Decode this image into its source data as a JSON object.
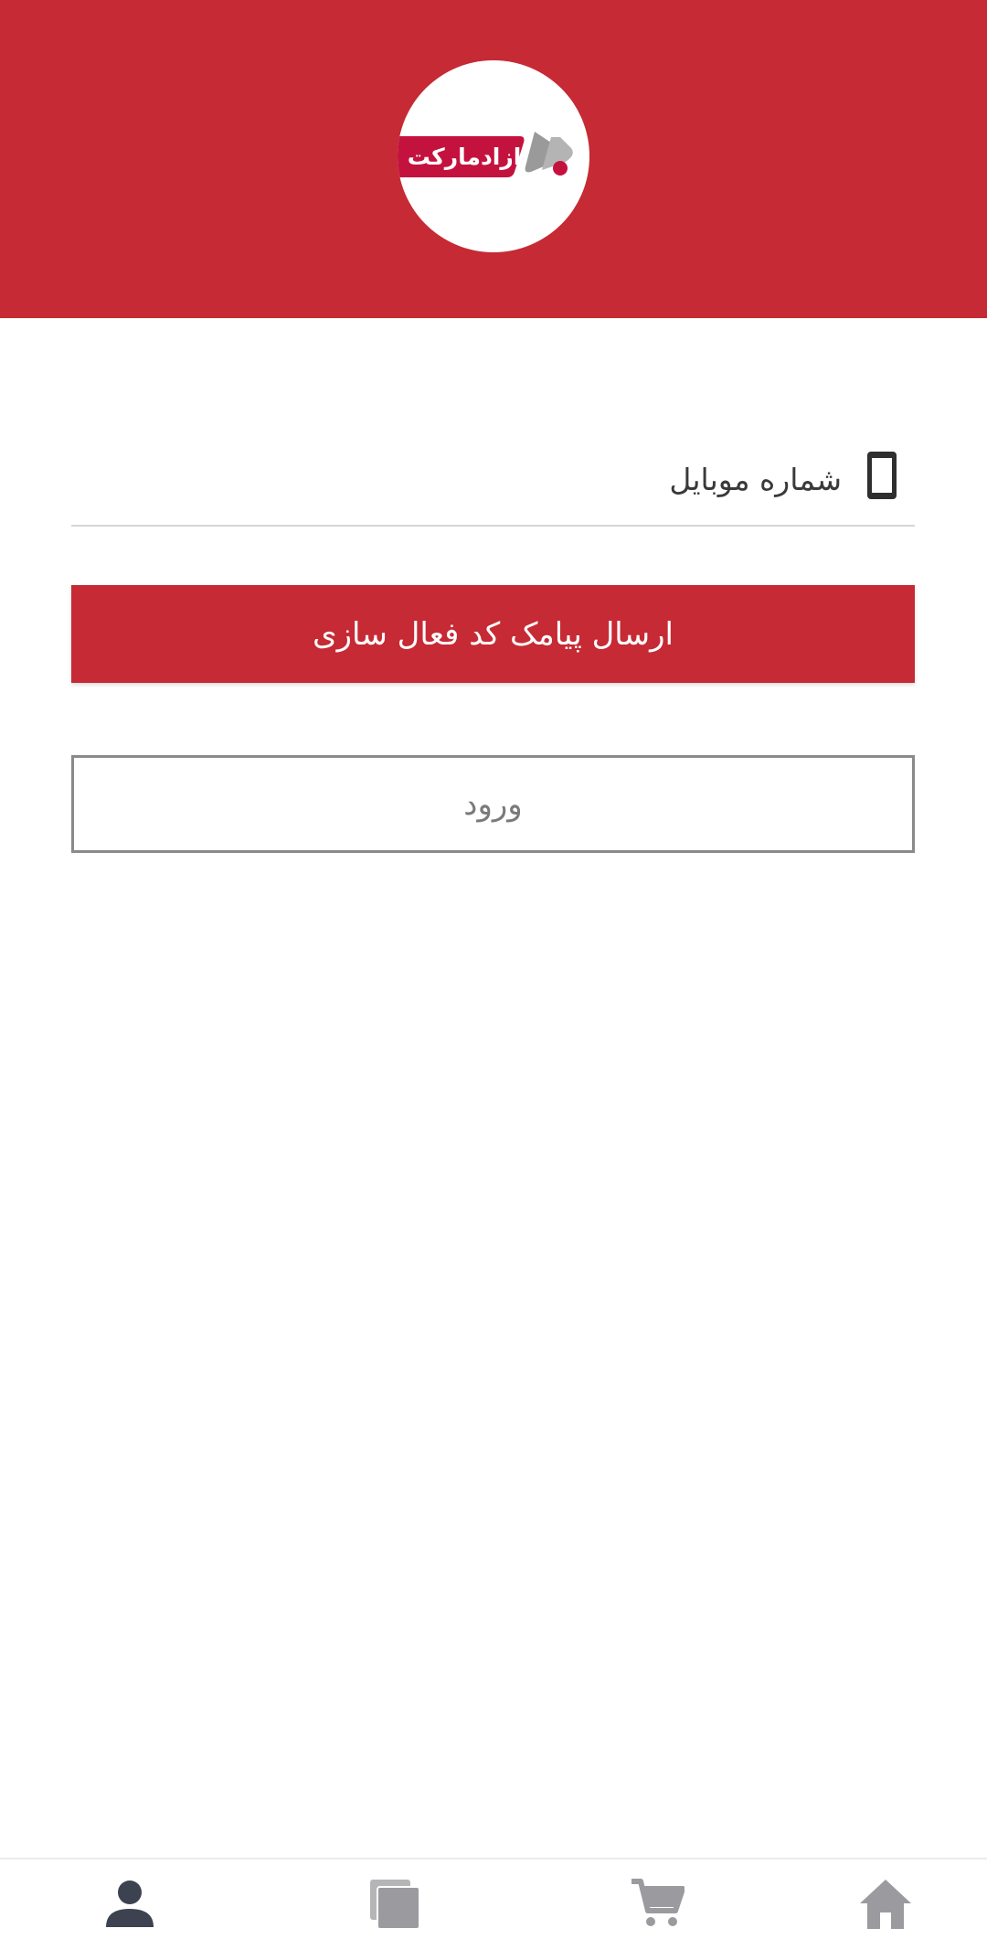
{
  "header": {
    "background_color": "#c62a34",
    "logo": {
      "text": "ازادمارکت",
      "icon_name": "azad-market-logo-icon"
    }
  },
  "form": {
    "phone": {
      "placeholder": "شماره موبایل",
      "value": "",
      "icon": "mobile-phone-icon"
    },
    "send_code_label": "ارسال پیامک کد فعال سازی",
    "login_label": "ورود"
  },
  "bottom_nav": {
    "items": [
      {
        "name": "profile",
        "icon": "user-icon",
        "active": true
      },
      {
        "name": "categories",
        "icon": "stacked-cards-icon",
        "active": false
      },
      {
        "name": "cart",
        "icon": "cart-icon",
        "active": false
      },
      {
        "name": "home",
        "icon": "home-icon",
        "active": false
      }
    ],
    "active_color": "#3d4250",
    "inactive_color": "#9b9b9f"
  }
}
